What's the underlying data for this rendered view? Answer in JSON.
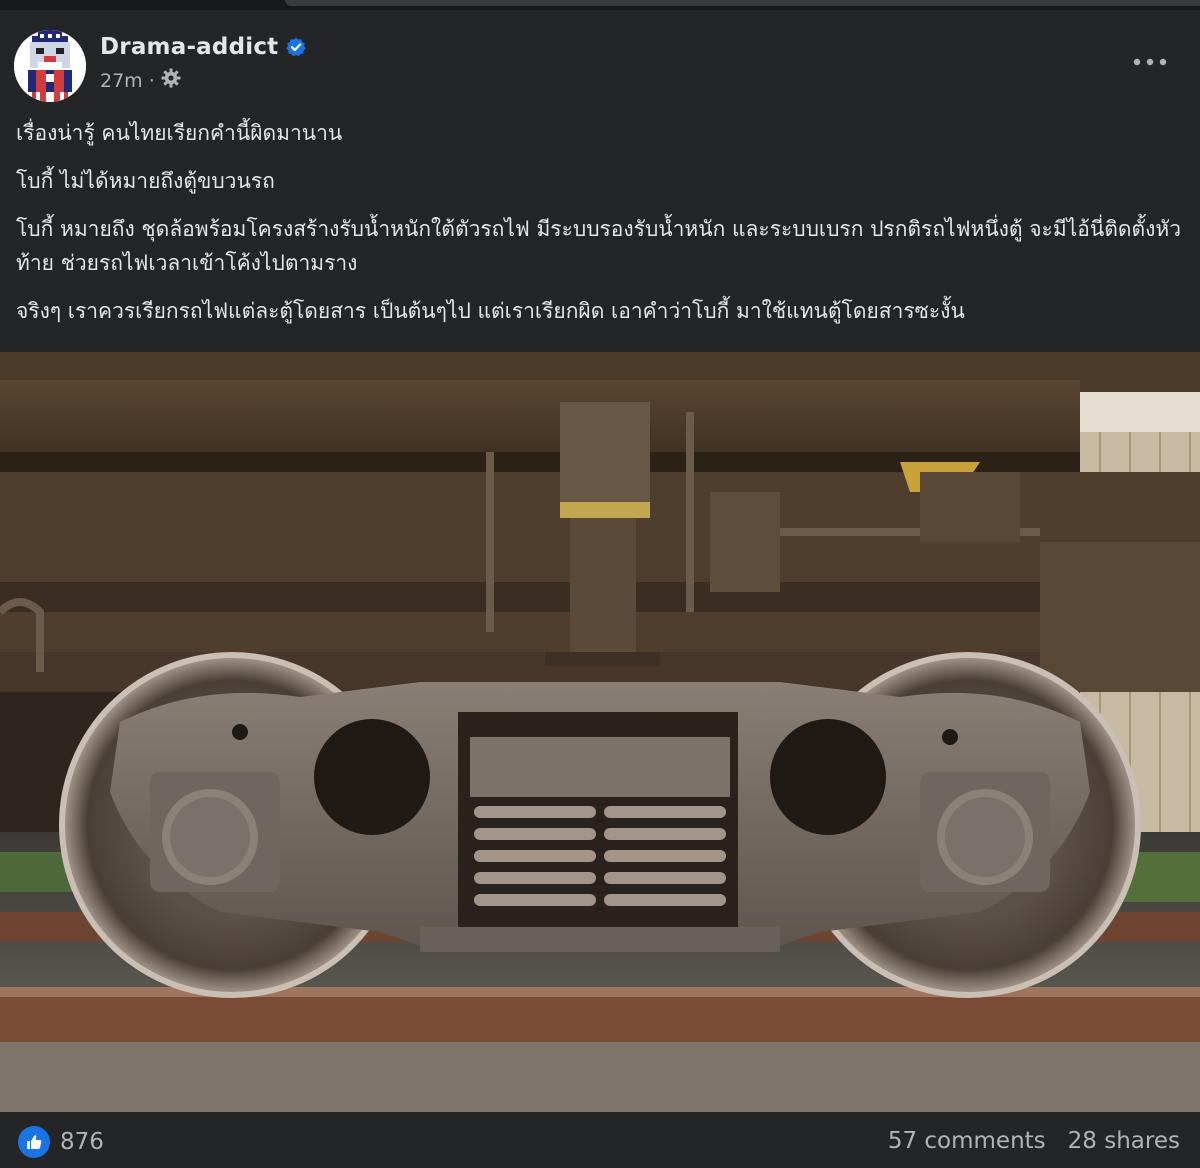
{
  "post": {
    "author": "Drama-addict",
    "verified_icon": "verified-badge-icon",
    "time": "27m",
    "separator": "·",
    "audience_icon": "gear-icon",
    "more_icon": "more-options-icon",
    "paragraphs": [
      "เรื่องน่ารู้ คนไทยเรียกคำนี้ผิดมานาน",
      "โบกี้ ไม่ได้หมายถึงตู้ขบวนรถ",
      "โบกี้ หมายถึง ชุดล้อพร้อมโครงสร้างรับน้ำหนักใต้ตัวรถไฟ มีระบบรองรับน้ำหนัก และระบบเบรก ปรกติรถไฟหนึ่งตู้ จะมีไอ้นี่ติดตั้งหัวท้าย ช่วยรถไฟเวลาเข้าโค้งไปตามราง",
      "จริงๆ เราควรเรียกรถไฟแต่ละตู้โดยสาร เป็นต้นๆไป แต่เราเรียกผิด เอาคำว่าโบกี้ มาใช้แทนตู้โดยสารซะงั้น"
    ]
  },
  "photo": {
    "subject": "railway bogie"
  },
  "footer": {
    "like_icon": "like-thumb-icon",
    "reaction_count": "876",
    "comments": "57 comments",
    "shares": "28 shares"
  },
  "colors": {
    "background": "#242526",
    "text": "#e4e6eb",
    "muted": "#b0b3b8",
    "accent": "#1b74e4"
  }
}
